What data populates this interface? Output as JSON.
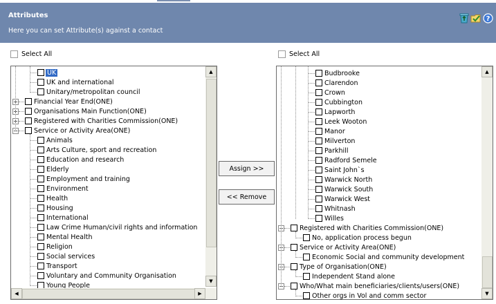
{
  "header": {
    "title": "Attributes",
    "subtitle": "Here you can set Attribute(s) against a contact",
    "icons": [
      "recycle-bin-icon",
      "folder-check-icon",
      "help-icon"
    ]
  },
  "left": {
    "select_all": "Select All",
    "rows": [
      {
        "label": "UK",
        "selected": true
      },
      {
        "label": "UK and international"
      },
      {
        "label": "Unitary/metropolitan council"
      },
      {
        "label": "Financial Year End(ONE)",
        "expander": "+"
      },
      {
        "label": "Organisations Main Function(ONE)",
        "expander": "+"
      },
      {
        "label": "Registered with Charities Commission(ONE)",
        "expander": "+"
      },
      {
        "label": "Service or Activity Area(ONE)",
        "expander": "-"
      },
      {
        "label": "Animals"
      },
      {
        "label": "Arts Culture, sport and recreation"
      },
      {
        "label": "Education and research"
      },
      {
        "label": "Elderly"
      },
      {
        "label": "Employment and training"
      },
      {
        "label": "Environment"
      },
      {
        "label": "Health"
      },
      {
        "label": "Housing"
      },
      {
        "label": "International"
      },
      {
        "label": "Law Crime Human/civil rights and information"
      },
      {
        "label": "Mental Health"
      },
      {
        "label": "Religion"
      },
      {
        "label": "Social services"
      },
      {
        "label": "Transport"
      },
      {
        "label": "Voluntary and Community Organisation"
      },
      {
        "label": "Young People"
      }
    ]
  },
  "right": {
    "select_all": "Select All",
    "rows": [
      {
        "label": "Budbrooke"
      },
      {
        "label": "Clarendon"
      },
      {
        "label": "Crown"
      },
      {
        "label": "Cubbington"
      },
      {
        "label": "Lapworth"
      },
      {
        "label": "Leek Wooton"
      },
      {
        "label": "Manor"
      },
      {
        "label": "Milverton"
      },
      {
        "label": "Parkhill"
      },
      {
        "label": "Radford Semele"
      },
      {
        "label": "Saint John`s"
      },
      {
        "label": "Warwick North"
      },
      {
        "label": "Warwick South"
      },
      {
        "label": "Warwick West"
      },
      {
        "label": "Whitnash"
      },
      {
        "label": "Willes"
      },
      {
        "label": "Registered with Charities Commission(ONE)",
        "expander": "-"
      },
      {
        "label": "No, application process begun"
      },
      {
        "label": "Service or Activity Area(ONE)",
        "expander": "-"
      },
      {
        "label": "Economic Social and community development"
      },
      {
        "label": "Type of Organisation(ONE)",
        "expander": "-"
      },
      {
        "label": "Independent Stand alone"
      },
      {
        "label": "Who/What main beneficiaries/clients/users(ONE)",
        "expander": "-"
      },
      {
        "label": "Other orgs in Vol and comm sector"
      }
    ]
  },
  "buttons": {
    "assign": "Assign >>",
    "remove": "<< Remove"
  },
  "colors": {
    "header_bg": "#6f87ad",
    "selection": "#316ac5"
  }
}
